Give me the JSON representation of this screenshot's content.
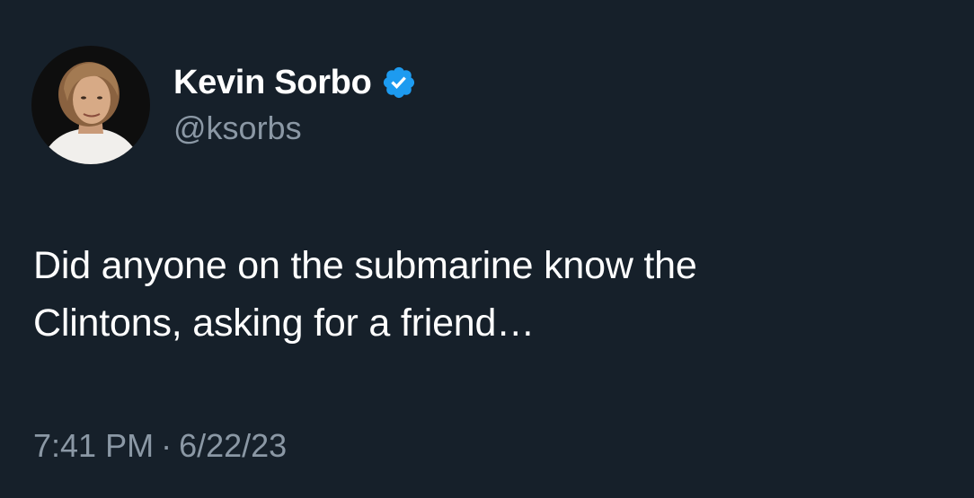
{
  "author": {
    "display_name": "Kevin Sorbo",
    "handle": "@ksorbs",
    "verified": true,
    "avatar_icon": "profile-photo"
  },
  "tweet": {
    "line1": "Did anyone on the submarine know the",
    "line2": "Clintons, asking for a friend…"
  },
  "meta": {
    "time": "7:41 PM",
    "separator": "·",
    "date": "6/22/23"
  },
  "colors": {
    "background": "#16202a",
    "text_primary": "#ffffff",
    "text_secondary": "#8b98a5",
    "verified_badge": "#1d9bf0"
  }
}
